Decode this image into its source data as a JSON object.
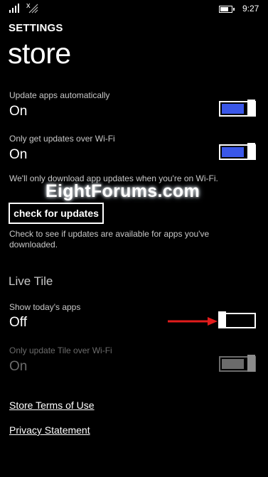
{
  "status_bar": {
    "clock": "9:27",
    "signal_x": "x",
    "icons": [
      "signal-bars-icon",
      "no-signal-icon",
      "wifi-icon",
      "battery-icon"
    ]
  },
  "header": {
    "settings_label": "SETTINGS",
    "title": "store"
  },
  "updates": {
    "auto_update": {
      "label": "Update apps automatically",
      "state": "On",
      "on": true
    },
    "wifi_only": {
      "label": "Only get updates over Wi-Fi",
      "state": "On",
      "on": true
    },
    "wifi_note": "We'll only download app updates when you're on Wi-Fi.",
    "check_button": "check for updates",
    "check_note_line1": "Check to see if updates are available for apps you've",
    "check_note_line2": "downloaded."
  },
  "watermark": "EightForums.com",
  "live_tile": {
    "section_title": "Live Tile",
    "show_today": {
      "label": "Show today's apps",
      "state": "Off",
      "on": false
    },
    "tile_wifi_only": {
      "label": "Only update Tile over Wi-Fi",
      "state": "On",
      "on": true,
      "disabled": true
    }
  },
  "links": {
    "terms": "Store Terms of Use",
    "privacy": "Privacy Statement"
  },
  "colors": {
    "accent": "#3a57e8",
    "background": "#000000",
    "text": "#ffffff",
    "subtext": "#c8c8c8",
    "disabled": "#6b6b6b",
    "arrow": "#e21c1c"
  }
}
